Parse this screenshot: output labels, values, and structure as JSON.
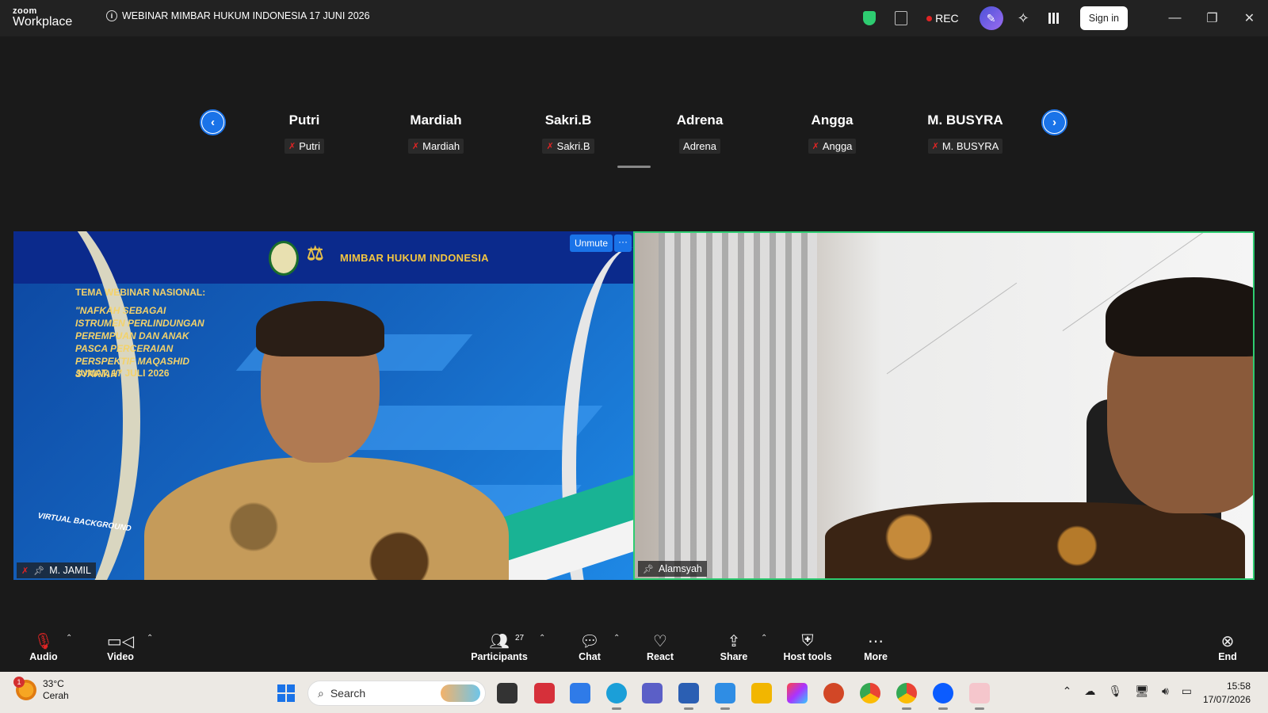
{
  "app": {
    "logo_top": "zoom",
    "logo_bottom": "Workplace"
  },
  "meeting": {
    "title": "WEBINAR MIMBAR HUKUM INDONESIA 17 JUNI 2026"
  },
  "titlebar": {
    "rec_label": "REC",
    "signin_label": "Sign in"
  },
  "strip": {
    "participants": [
      {
        "name": "Putri",
        "tag": "Putri",
        "muted": true
      },
      {
        "name": "Mardiah",
        "tag": "Mardiah",
        "muted": true
      },
      {
        "name": "Sakri.B",
        "tag": "Sakri.B",
        "muted": true
      },
      {
        "name": "Adrena",
        "tag": "Adrena",
        "muted": false
      },
      {
        "name": "Angga",
        "tag": "Angga",
        "muted": true
      },
      {
        "name": "M. BUSYRA",
        "tag": "M. BUSYRA",
        "muted": true
      }
    ]
  },
  "videos": {
    "left": {
      "name": "M. JAMIL",
      "unmute_label": "Unmute",
      "more_label": "···",
      "banner_title": "MIMBAR HUKUM INDONESIA",
      "webinar_label": "TEMA WEBINAR NASIONAL:",
      "webinar_theme": "\"NAFKAH SEBAGAI ISTRUMEN PERLINDUNGAN PEREMPUAN DAN ANAK PASCA PERCERAIAN PERSPEKTIF MAQASHID SYARIAH\"",
      "webinar_date": "JUMAT, 17 JULI 2026",
      "vb_label": "VIRTUAL BACKGROUND"
    },
    "right": {
      "name": "Alamsyah"
    }
  },
  "toolbar": {
    "audio": "Audio",
    "video": "Video",
    "participants": "Participants",
    "participant_count": "27",
    "chat": "Chat",
    "react": "React",
    "share": "Share",
    "host_tools": "Host tools",
    "more": "More",
    "end": "End"
  },
  "taskbar": {
    "weather_temp": "33°C",
    "weather_desc": "Cerah",
    "weather_badge": "1",
    "search_placeholder": "Search",
    "time": "15:58",
    "date": "17/07/2026"
  },
  "colors": {
    "accent": "#1a73e8",
    "active_speaker": "#2ecc71",
    "danger": "#e02424"
  }
}
